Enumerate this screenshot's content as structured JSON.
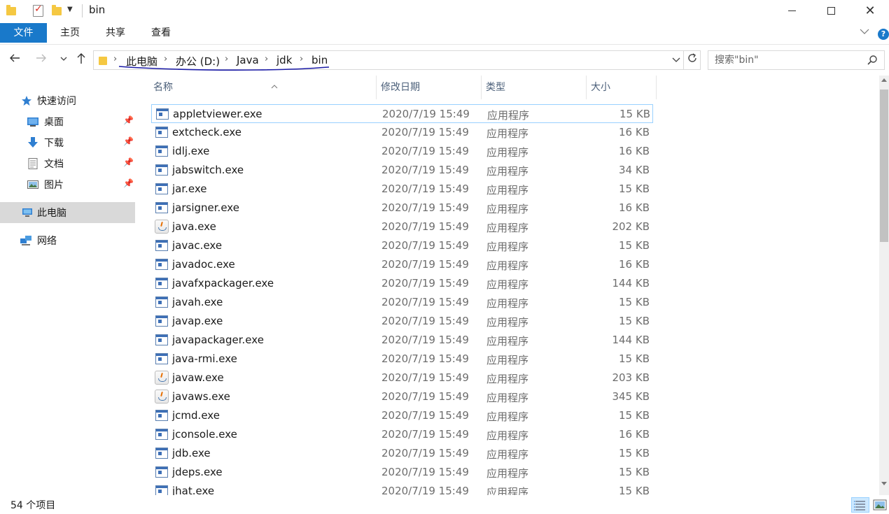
{
  "window": {
    "title": "bin",
    "close_glyph": "✕"
  },
  "ribbon": {
    "tabs": [
      "文件",
      "主页",
      "共享",
      "查看"
    ],
    "help_glyph": "?"
  },
  "address": {
    "crumbs": [
      "此电脑",
      "办公 (D:)",
      "Java",
      "jdk",
      "bin"
    ],
    "separator": "›",
    "underline_color": "#1a1aa6"
  },
  "search": {
    "placeholder": "搜索\"bin\""
  },
  "navpane": {
    "quick_access": "快速访问",
    "items": [
      "桌面",
      "下载",
      "文档",
      "图片"
    ],
    "this_pc": "此电脑",
    "network": "网络"
  },
  "columns": {
    "name": "名称",
    "date": "修改日期",
    "type": "类型",
    "size": "大小"
  },
  "files": [
    {
      "name": "appletviewer.exe",
      "date": "2020/7/19 15:49",
      "type": "应用程序",
      "size": "15 KB",
      "icon": "exe",
      "selected": true
    },
    {
      "name": "extcheck.exe",
      "date": "2020/7/19 15:49",
      "type": "应用程序",
      "size": "16 KB",
      "icon": "exe"
    },
    {
      "name": "idlj.exe",
      "date": "2020/7/19 15:49",
      "type": "应用程序",
      "size": "16 KB",
      "icon": "exe"
    },
    {
      "name": "jabswitch.exe",
      "date": "2020/7/19 15:49",
      "type": "应用程序",
      "size": "34 KB",
      "icon": "exe"
    },
    {
      "name": "jar.exe",
      "date": "2020/7/19 15:49",
      "type": "应用程序",
      "size": "15 KB",
      "icon": "exe"
    },
    {
      "name": "jarsigner.exe",
      "date": "2020/7/19 15:49",
      "type": "应用程序",
      "size": "16 KB",
      "icon": "exe"
    },
    {
      "name": "java.exe",
      "date": "2020/7/19 15:49",
      "type": "应用程序",
      "size": "202 KB",
      "icon": "java"
    },
    {
      "name": "javac.exe",
      "date": "2020/7/19 15:49",
      "type": "应用程序",
      "size": "15 KB",
      "icon": "exe"
    },
    {
      "name": "javadoc.exe",
      "date": "2020/7/19 15:49",
      "type": "应用程序",
      "size": "16 KB",
      "icon": "exe"
    },
    {
      "name": "javafxpackager.exe",
      "date": "2020/7/19 15:49",
      "type": "应用程序",
      "size": "144 KB",
      "icon": "exe"
    },
    {
      "name": "javah.exe",
      "date": "2020/7/19 15:49",
      "type": "应用程序",
      "size": "15 KB",
      "icon": "exe"
    },
    {
      "name": "javap.exe",
      "date": "2020/7/19 15:49",
      "type": "应用程序",
      "size": "15 KB",
      "icon": "exe"
    },
    {
      "name": "javapackager.exe",
      "date": "2020/7/19 15:49",
      "type": "应用程序",
      "size": "144 KB",
      "icon": "exe"
    },
    {
      "name": "java-rmi.exe",
      "date": "2020/7/19 15:49",
      "type": "应用程序",
      "size": "15 KB",
      "icon": "exe"
    },
    {
      "name": "javaw.exe",
      "date": "2020/7/19 15:49",
      "type": "应用程序",
      "size": "203 KB",
      "icon": "java"
    },
    {
      "name": "javaws.exe",
      "date": "2020/7/19 15:49",
      "type": "应用程序",
      "size": "345 KB",
      "icon": "java"
    },
    {
      "name": "jcmd.exe",
      "date": "2020/7/19 15:49",
      "type": "应用程序",
      "size": "15 KB",
      "icon": "exe"
    },
    {
      "name": "jconsole.exe",
      "date": "2020/7/19 15:49",
      "type": "应用程序",
      "size": "16 KB",
      "icon": "exe"
    },
    {
      "name": "jdb.exe",
      "date": "2020/7/19 15:49",
      "type": "应用程序",
      "size": "15 KB",
      "icon": "exe"
    },
    {
      "name": "jdeps.exe",
      "date": "2020/7/19 15:49",
      "type": "应用程序",
      "size": "15 KB",
      "icon": "exe"
    },
    {
      "name": "jhat.exe",
      "date": "2020/7/19 15:49",
      "type": "应用程序",
      "size": "15 KB",
      "icon": "exe"
    }
  ],
  "status": {
    "item_count": "54 个项目"
  },
  "colors": {
    "accent": "#1979ca",
    "selection_border": "#99d1ff",
    "nav_selected_bg": "#d9d9d9"
  }
}
